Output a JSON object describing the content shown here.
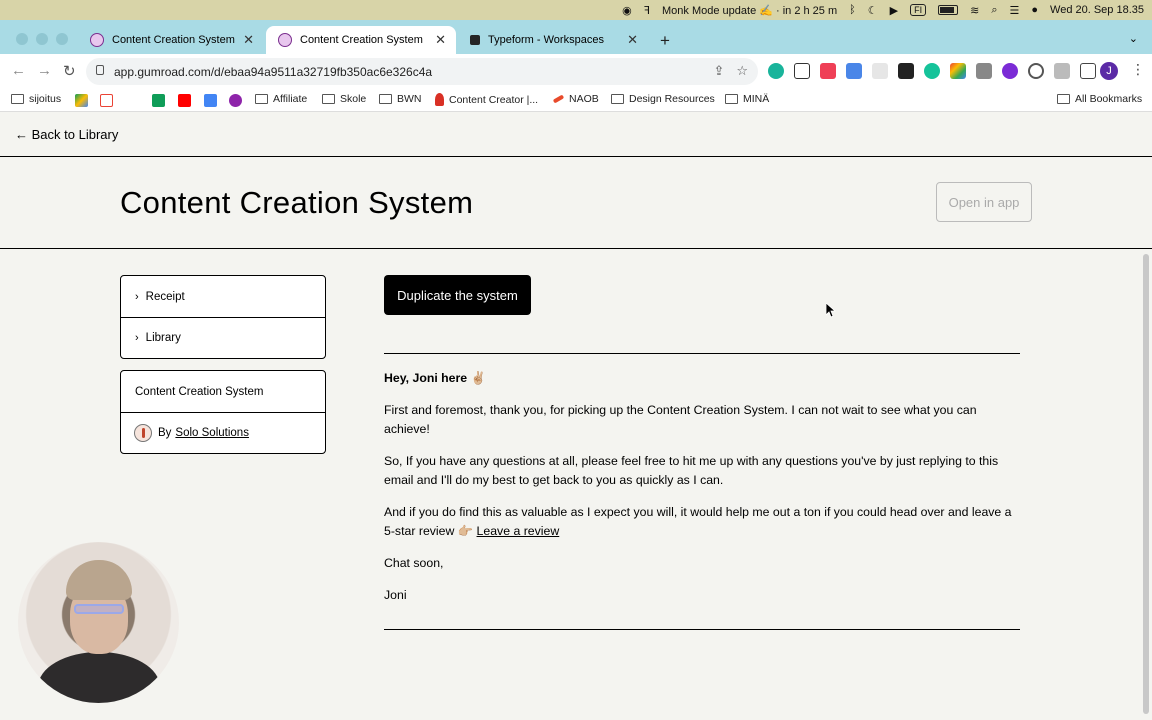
{
  "menubar": {
    "now_playing": "Monk Mode update ✍️ · in 2 h 25 m",
    "input_source": "FI",
    "datetime": "Wed 20. Sep  18.35"
  },
  "tabs": [
    {
      "title": "Content Creation System",
      "active": false
    },
    {
      "title": "Content Creation System",
      "active": true
    },
    {
      "title": "Typeform - Workspaces",
      "active": false
    }
  ],
  "address_bar": {
    "url": "app.gumroad.com/d/ebaa94a9511a32719fb350ac6e326c4a"
  },
  "profile_initial": "J",
  "bookmarks": [
    {
      "label": "sijoitus",
      "type": "folder"
    },
    {
      "label": "Affiliate",
      "type": "folder"
    },
    {
      "label": "Skole",
      "type": "folder"
    },
    {
      "label": "BWN",
      "type": "folder"
    },
    {
      "label": "Content Creator |...",
      "type": "site"
    },
    {
      "label": "NAOB",
      "type": "site"
    },
    {
      "label": "Design Resources",
      "type": "folder"
    },
    {
      "label": "MINÄ",
      "type": "folder"
    },
    {
      "label": "All Bookmarks",
      "type": "folder"
    }
  ],
  "page": {
    "back_label": "Back to Library",
    "title": "Content Creation System",
    "open_in_app": "Open in app",
    "sidebar": {
      "receipt": "Receipt",
      "library": "Library",
      "product_name": "Content Creation System",
      "by_prefix": "By",
      "creator": "Solo Solutions"
    },
    "duplicate_button": "Duplicate the system",
    "greeting": "Hey, Joni here ✌🏼",
    "p1": "First and foremost, thank you, for picking up the Content Creation System. I can not wait to see what you can achieve!",
    "p2": "So, If you have any questions at all, please feel free to hit me up with any questions you've by just replying to this email and I'll do my best to get back to you as quickly as I can.",
    "p3_prefix": "And if you do find this as valuable as I expect you will, it would help me out a ton if you could head over and leave a 5-star review 👉🏼 ",
    "p3_link": "Leave a review",
    "p4": "Chat soon,",
    "p5": "Joni"
  }
}
